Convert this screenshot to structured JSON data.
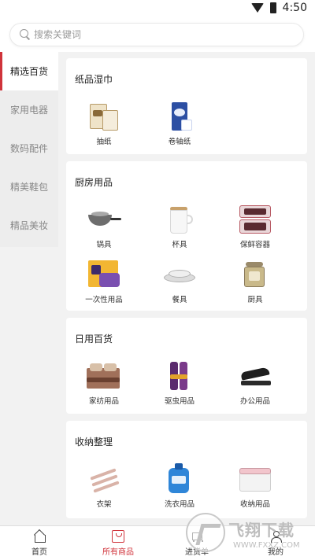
{
  "status_bar": {
    "time": "4:50",
    "icons": [
      "wifi-icon",
      "battery-icon"
    ]
  },
  "search": {
    "placeholder": "搜索关键词",
    "value": ""
  },
  "sidebar": {
    "items": [
      {
        "label": "精选百货",
        "active": true
      },
      {
        "label": "家用电器",
        "active": false
      },
      {
        "label": "数码配件",
        "active": false
      },
      {
        "label": "精美鞋包",
        "active": false
      },
      {
        "label": "精品美妆",
        "active": false
      }
    ]
  },
  "categories": [
    {
      "title": "纸品湿巾",
      "items": [
        {
          "label": "抽纸",
          "icon": "tissue-box-icon"
        },
        {
          "label": "卷轴纸",
          "icon": "paper-roll-icon"
        }
      ]
    },
    {
      "title": "厨房用品",
      "items": [
        {
          "label": "锅具",
          "icon": "wok-icon"
        },
        {
          "label": "杯具",
          "icon": "mug-icon"
        },
        {
          "label": "保鲜容器",
          "icon": "food-container-icon"
        },
        {
          "label": "一次性用品",
          "icon": "disposable-bags-icon"
        },
        {
          "label": "餐具",
          "icon": "dinnerware-icon"
        },
        {
          "label": "厨具",
          "icon": "cookware-icon"
        }
      ]
    },
    {
      "title": "日用百货",
      "items": [
        {
          "label": "家纺用品",
          "icon": "bedding-icon"
        },
        {
          "label": "驱虫用品",
          "icon": "insect-spray-icon"
        },
        {
          "label": "办公用品",
          "icon": "stapler-icon"
        }
      ]
    },
    {
      "title": "收纳整理",
      "items": [
        {
          "label": "衣架",
          "icon": "hanger-icon"
        },
        {
          "label": "洗衣用品",
          "icon": "detergent-icon"
        },
        {
          "label": "收纳用品",
          "icon": "storage-box-icon"
        }
      ]
    }
  ],
  "bottom_nav": {
    "tabs": [
      {
        "label": "首页",
        "icon": "home-icon",
        "active": false
      },
      {
        "label": "所有商品",
        "icon": "shopping-bag-icon",
        "active": true
      },
      {
        "label": "进货单",
        "icon": "cart-icon",
        "active": false
      },
      {
        "label": "我的",
        "icon": "user-icon",
        "active": false
      }
    ]
  },
  "watermark": {
    "brand": "飞翔下载",
    "url": "WWW.FXXZ.COM"
  },
  "colors": {
    "accent": "#d0333b",
    "background": "#f2f2f2",
    "card": "#ffffff"
  }
}
